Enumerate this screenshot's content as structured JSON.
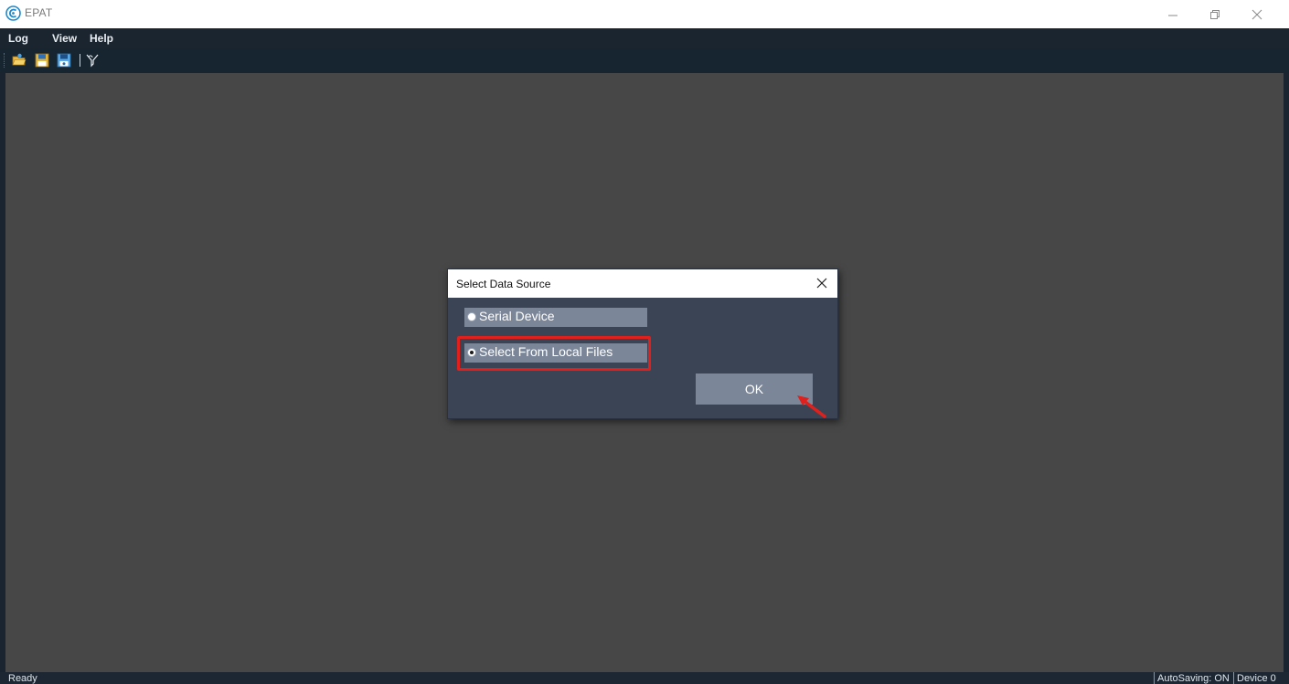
{
  "window": {
    "title": "EPAT",
    "controls": [
      "minimize",
      "restore",
      "close"
    ]
  },
  "menu": {
    "items": [
      "Log",
      "View",
      "Help"
    ]
  },
  "toolbar": {
    "icons": [
      "open-folder-icon",
      "save-icon",
      "save-as-icon",
      "filter-icon"
    ]
  },
  "dialog": {
    "title": "Select Data Source",
    "options": [
      {
        "label": "Serial Device",
        "selected": false
      },
      {
        "label": "Select From Local Files",
        "selected": true
      }
    ],
    "ok_label": "OK",
    "highlighted_option": "Select From Local Files"
  },
  "status": {
    "left": "Ready",
    "autosave": "AutoSaving: ON",
    "device": "Device 0"
  },
  "colors": {
    "menu_bar": "#1b2530",
    "workspace": "#474747",
    "dialog_body": "#3b4454",
    "control_bg": "#7b8799",
    "annotation": "#e0201c"
  }
}
